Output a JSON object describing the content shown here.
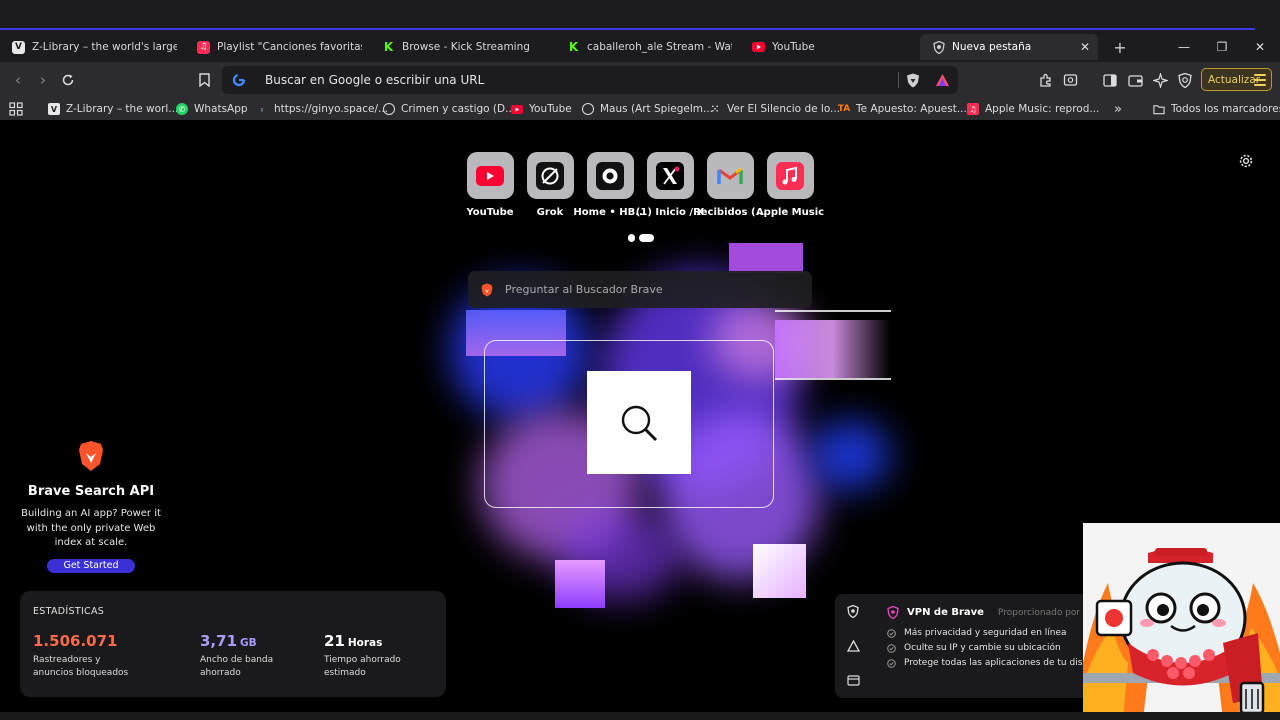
{
  "tabs": [
    {
      "title": "Z-Library – the world's largest e",
      "icon": "zlibrary-icon",
      "color": "#ffffff"
    },
    {
      "title": "Playlist \"Canciones favoritas\" en",
      "icon": "apple-music-icon",
      "color": "#fa2d55"
    },
    {
      "title": "Browse - Kick Streaming",
      "icon": "kick-icon",
      "color": "#53fc18"
    },
    {
      "title": "caballeroh_ale Stream - Watch L",
      "icon": "kick-icon",
      "color": "#53fc18"
    },
    {
      "title": "YouTube",
      "icon": "youtube-icon",
      "color": "#ff0033"
    },
    {
      "title": "Nueva pestaña",
      "icon": "brave-shield-icon",
      "active": true
    }
  ],
  "toolbar": {
    "omnibox_placeholder": "Buscar en Google o escribir una URL",
    "update_label": "Actualizar"
  },
  "bookmarks": [
    {
      "label": "Z-Library – the worl...",
      "icon": "zlibrary-icon"
    },
    {
      "label": "WhatsApp",
      "icon": "whatsapp-icon"
    },
    {
      "label": "https://ginyo.space/...",
      "icon": "link-icon"
    },
    {
      "label": "Crimen y castigo (D...",
      "icon": "globe-icon"
    },
    {
      "label": "YouTube",
      "icon": "youtube-icon"
    },
    {
      "label": "Maus (Art Spiegelm...",
      "icon": "globe-icon"
    },
    {
      "label": "Ver El Silencio de lo...",
      "icon": "grid-icon"
    },
    {
      "label": "Te Apuesto: Apuest...",
      "icon": "ta-icon"
    },
    {
      "label": "Apple Music: reprod...",
      "icon": "apple-music-icon"
    },
    {
      "label": "»",
      "icon": ""
    },
    {
      "label": "Todos los marcadores",
      "icon": "folder-icon"
    }
  ],
  "top_sites": [
    {
      "label": "YouTube",
      "icon": "youtube-icon"
    },
    {
      "label": "Grok",
      "icon": "grok-icon"
    },
    {
      "label": "Home • HB...",
      "icon": "hbo-icon"
    },
    {
      "label": "(1) Inicio / X",
      "icon": "x-icon"
    },
    {
      "label": "Recibidos (...",
      "icon": "gmail-icon"
    },
    {
      "label": "Apple Music",
      "icon": "apple-music-icon"
    }
  ],
  "brave_search": {
    "placeholder": "Preguntar al Buscador Brave"
  },
  "promo": {
    "title": "Brave Search API",
    "body": "Building an AI app? Power it with the only private Web index at scale.",
    "cta": "Get Started"
  },
  "stats": {
    "heading": "ESTADÍSTICAS",
    "items": [
      {
        "value": "1.506.071",
        "unit": "",
        "desc": "Rastreadores y anuncios bloqueados",
        "color": "#ff6a4a"
      },
      {
        "value": "3,71",
        "unit": "GB",
        "desc": "Ancho de banda ahorrado",
        "color": "#a99cff"
      },
      {
        "value": "21",
        "unit": "Horas",
        "desc": "Tiempo ahorrado estimado",
        "color": "#ffffff"
      }
    ]
  },
  "vpn": {
    "title": "VPN de Brave",
    "provider": "Proporcionado por",
    "features": [
      "Más privacidad y seguridad en línea",
      "Oculte su IP y cambie su ubicación",
      "Protege todas las aplicaciones de tu dispositi"
    ]
  },
  "colors": {
    "accent_line": "#3b3be0",
    "update_border": "#b89b2a",
    "cta": "#3b2fd6"
  }
}
